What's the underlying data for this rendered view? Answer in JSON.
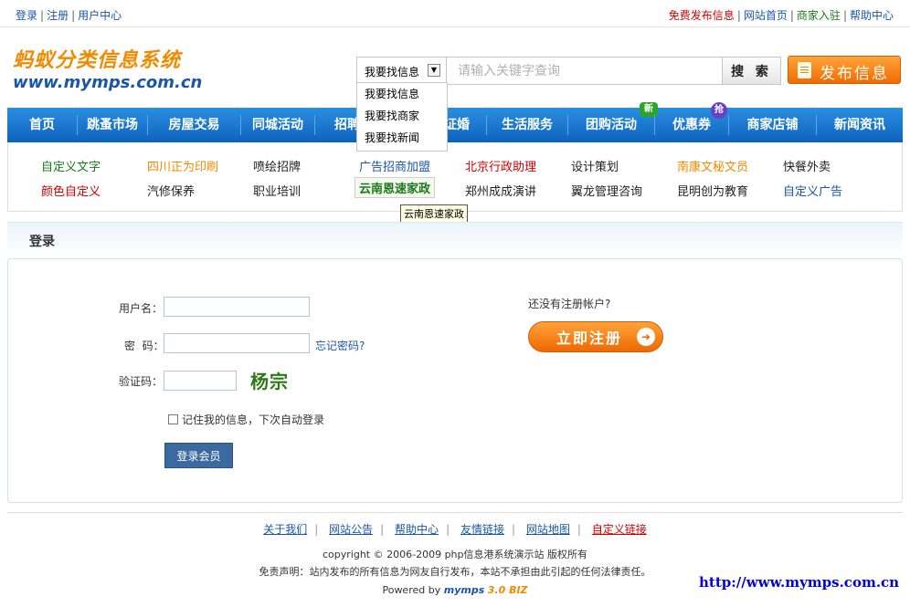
{
  "topbar": {
    "login": "登录",
    "register": "注册",
    "user_center": "用户中心",
    "post_free": "免费发布信息",
    "home": "网站首页",
    "merchant_join": "商家入驻",
    "help": "帮助中心"
  },
  "header": {
    "logo_cn": "蚂蚁分类信息系统",
    "logo_en": "www.mymps.com.cn"
  },
  "search": {
    "selected": "我要找信息",
    "placeholder": "请输入关键字查询",
    "button": "搜 索",
    "options": [
      "我要找信息",
      "我要找商家",
      "我要找新闻"
    ]
  },
  "post_button": "发布信息",
  "nav": {
    "items": [
      "首页",
      "跳蚤市场",
      "房屋交易",
      "同城活动",
      "招聘",
      "证婚",
      "生活服务",
      "团购活动",
      "优惠券",
      "商家店铺",
      "新闻资讯"
    ],
    "badge_new": "新",
    "badge_grab": "抢"
  },
  "ad_links": {
    "row1": [
      "自定义文字",
      "四川正为印刷",
      "喷绘招牌",
      "广告招商加盟",
      "北京行政助理",
      "设计策划",
      "南康文秘文员",
      "快餐外卖"
    ],
    "row2": [
      "颜色自定义",
      "汽修保养",
      "职业培训",
      "云南恩速家政",
      "郑州成成演讲",
      "翼龙管理咨询",
      "昆明创为教育",
      "自定义广告"
    ],
    "tooltip": "云南恩速家政"
  },
  "login": {
    "section_title": "登录",
    "username_label": "用户名：",
    "password_label": "密  码：",
    "forgot": "忘记密码?",
    "captcha_label": "验证码：",
    "captcha_text": "杨宗",
    "remember": "记住我的信息，下次自动登录",
    "submit": "登录会员",
    "no_account": "还没有注册帐户?",
    "register_now": "立即注册"
  },
  "footer": {
    "links": [
      "关于我们",
      "网站公告",
      "帮助中心",
      "友情链接",
      "网站地图",
      "自定义链接"
    ],
    "copyright": "copyright © 2006-2009 php信息港系统演示站  版权所有",
    "disclaimer": "免责声明：站内发布的所有信息为网友自行发布，本站不承担由此引起的任何法律责任。",
    "powered_prefix": "Powered by",
    "powered_brand": "mymps",
    "powered_version": "3.0 BIZ",
    "site_url": "http://www.mymps.com.cn"
  },
  "colors": {
    "nav_blue": "#0e62bd",
    "accent_orange": "#f28a00",
    "link_blue": "#1a56a8",
    "red": "#d40000"
  }
}
